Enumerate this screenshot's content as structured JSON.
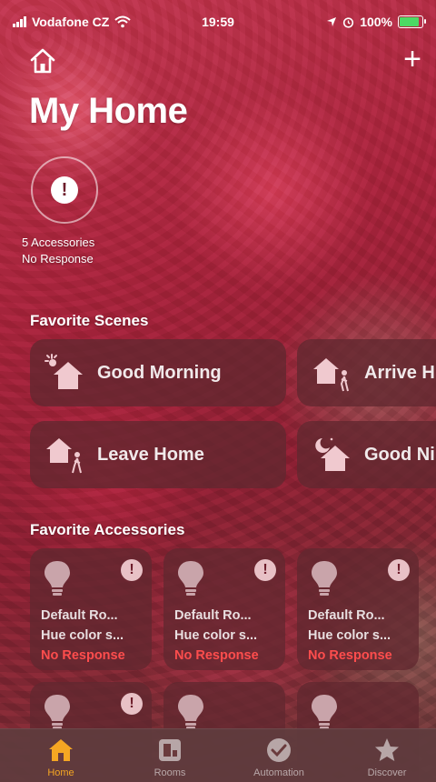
{
  "status_bar": {
    "carrier": "Vodafone CZ",
    "time": "19:59",
    "battery": "100%"
  },
  "header": {
    "title": "My Home",
    "add_label": "+"
  },
  "status": {
    "line1": "5 Accessories",
    "line2": "No Response"
  },
  "scenes_section": {
    "title": "Favorite Scenes",
    "items": [
      {
        "label": "Good Morning",
        "icon": "sunrise-house-icon"
      },
      {
        "label": "Arrive H",
        "icon": "arrive-home-icon"
      },
      {
        "label": "Leave Home",
        "icon": "leave-home-icon"
      },
      {
        "label": "Good Ni",
        "icon": "night-house-icon"
      }
    ]
  },
  "accessories_section": {
    "title": "Favorite Accessories",
    "items": [
      {
        "room": "Default Ro...",
        "name": "Hue color s...",
        "status": "No Response"
      },
      {
        "room": "Default Ro...",
        "name": "Hue color s...",
        "status": "No Response"
      },
      {
        "room": "Default Ro...",
        "name": "Hue color s...",
        "status": "No Response"
      }
    ]
  },
  "tab_bar": {
    "tabs": [
      {
        "label": "Home"
      },
      {
        "label": "Rooms"
      },
      {
        "label": "Automation"
      },
      {
        "label": "Discover"
      }
    ]
  },
  "colors": {
    "accent": "#f5a623",
    "error": "#ff4d4d",
    "battery": "#4cd964"
  }
}
